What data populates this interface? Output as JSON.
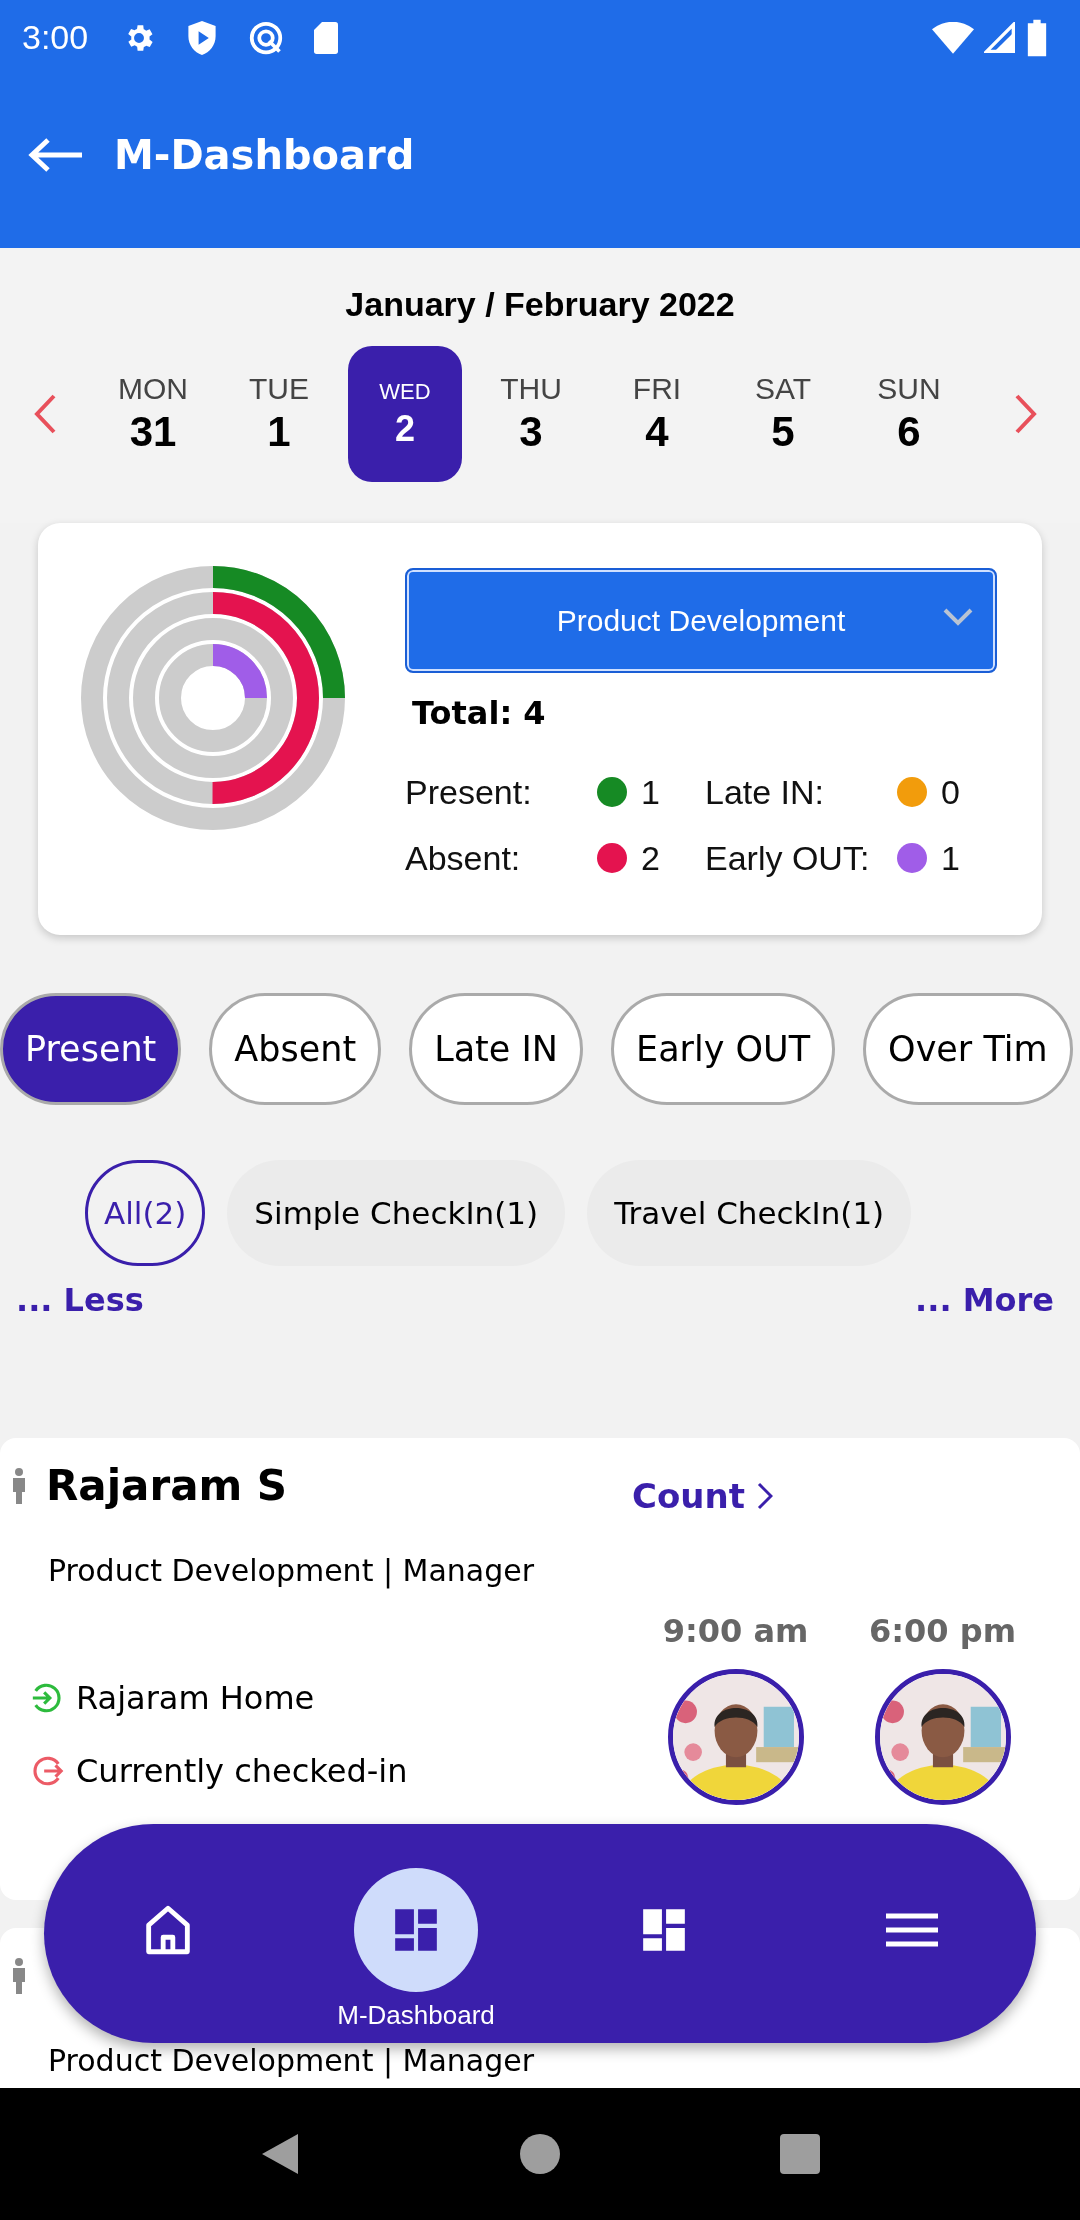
{
  "status_bar": {
    "time": "3:00"
  },
  "app_bar": {
    "title": "M-Dashboard"
  },
  "calendar": {
    "month": "January / February 2022",
    "days": [
      {
        "weekday": "MON",
        "date": "31",
        "selected": false
      },
      {
        "weekday": "TUE",
        "date": "1",
        "selected": false
      },
      {
        "weekday": "WED",
        "date": "2",
        "selected": true
      },
      {
        "weekday": "THU",
        "date": "3",
        "selected": false
      },
      {
        "weekday": "FRI",
        "date": "4",
        "selected": false
      },
      {
        "weekday": "SAT",
        "date": "5",
        "selected": false
      },
      {
        "weekday": "SUN",
        "date": "6",
        "selected": false
      }
    ]
  },
  "summary": {
    "department": "Product Development",
    "total": "Total: 4",
    "legend": [
      {
        "label": "Present:",
        "count": "1",
        "color": "#168a24",
        "level": 0.25
      },
      {
        "label": "Absent:",
        "count": "2",
        "color": "#e4134f",
        "level": 0.5
      },
      {
        "label": "Late IN:",
        "count": "0",
        "color": "#f29c0c",
        "level": 0
      },
      {
        "label": "Early OUT:",
        "count": "1",
        "color": "#a05de8",
        "level": 0.25
      }
    ]
  },
  "status_tabs": [
    {
      "label": "Present",
      "selected": true
    },
    {
      "label": "Absent",
      "selected": false
    },
    {
      "label": "Late IN",
      "selected": false
    },
    {
      "label": "Early OUT",
      "selected": false
    },
    {
      "label": "Over Tim",
      "selected": false
    }
  ],
  "checkin_filters": [
    {
      "label": "All(2)",
      "selected": true
    },
    {
      "label": "Simple CheckIn(1)",
      "selected": false
    },
    {
      "label": "Travel CheckIn(1)",
      "selected": false
    }
  ],
  "less_link": "... Less",
  "more_link": "... More",
  "employees": [
    {
      "name": "Rajaram S",
      "count_link": "Count",
      "subtitle": "Product Development | Manager",
      "check_in_time": "9:00 am",
      "check_out_time": "6:00 pm",
      "location": "Rajaram Home",
      "status": "Currently checked-in"
    },
    {
      "subtitle": "Product Development | Manager"
    }
  ],
  "bottom_nav": [
    {
      "kind": "home",
      "selected": false
    },
    {
      "kind": "dashboard",
      "label": "M-Dashboard",
      "selected": true
    },
    {
      "kind": "widgets",
      "selected": false
    },
    {
      "kind": "menu",
      "selected": false
    }
  ]
}
